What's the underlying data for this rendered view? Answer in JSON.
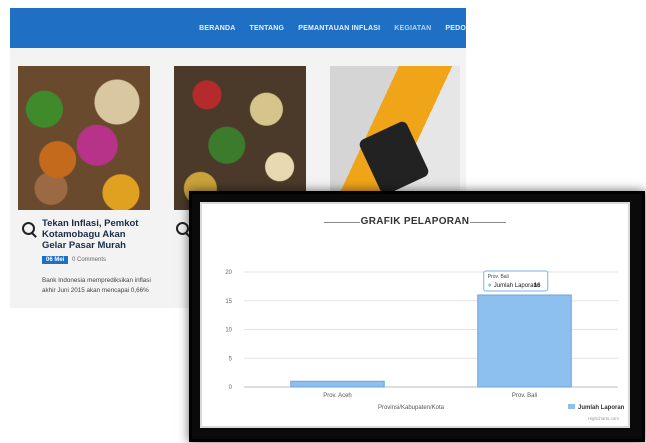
{
  "nav": {
    "items": [
      "BERANDA",
      "TENTANG",
      "PEMANTAUAN INFLASI",
      "KEGIATAN",
      "PEDO"
    ]
  },
  "post": {
    "title": "Tekan Inflasi, Pemkot Kotamobagu Akan Gelar Pasar Murah",
    "date_badge": "06 Mei",
    "comments": "0 Comments",
    "excerpt": "Bank Indonesia memprediksikan inflasi akhir Juni 2015 akan mencapai 0,66%"
  },
  "chart_data": {
    "type": "bar",
    "title": "GRAFIK PELAPORAN",
    "categories": [
      "Prov. Aceh",
      "Prov. Bali"
    ],
    "series": [
      {
        "name": "Jumlah Laporan",
        "values": [
          1,
          16
        ],
        "color": "#8ec0ef"
      }
    ],
    "xlabel": "Provinsi/Kabupaten/Kota",
    "ylabel": "",
    "ylim": [
      0,
      20
    ],
    "yticks": [
      0,
      5,
      10,
      15,
      20
    ],
    "grid": true,
    "legend": "bottom-right",
    "tooltip": {
      "category": "Prov. Bali",
      "series": "Jumlah Laporan",
      "value": 16
    },
    "credit": "Highcharts.com"
  },
  "colors": {
    "nav_bg": "#1f6fc4",
    "bar": "#8ec0ef",
    "bar_dark": "#6aa3dc"
  }
}
